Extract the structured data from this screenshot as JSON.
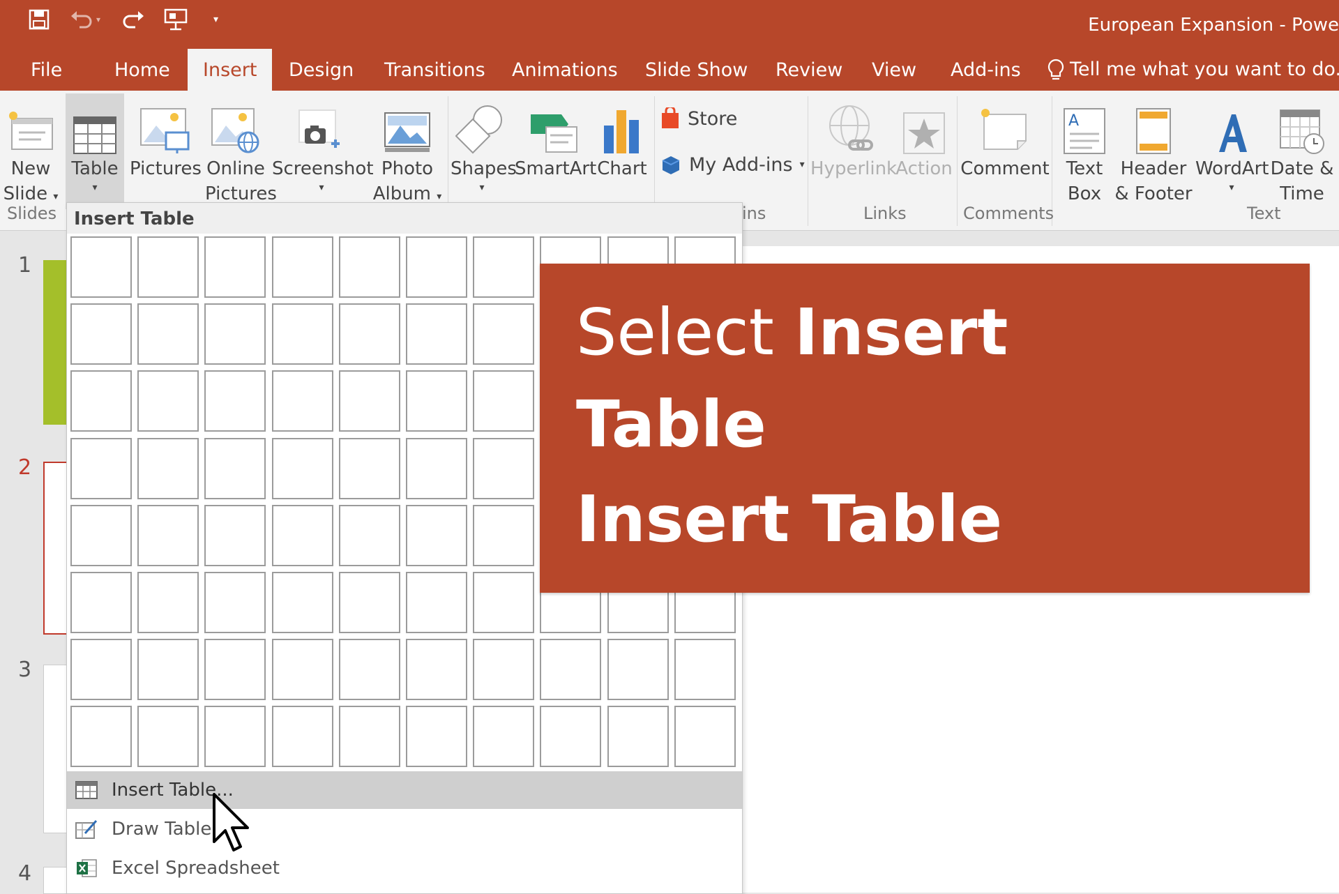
{
  "window": {
    "title": "European Expansion - Powe"
  },
  "quick_access": [
    {
      "icon": "save-icon"
    },
    {
      "icon": "undo-icon"
    },
    {
      "icon": "redo-icon"
    },
    {
      "icon": "present-from-start-icon"
    },
    {
      "icon": "customize-toolbar-icon"
    }
  ],
  "tabs": [
    {
      "label": "File"
    },
    {
      "label": "Home"
    },
    {
      "label": "Insert",
      "active": true
    },
    {
      "label": "Design"
    },
    {
      "label": "Transitions"
    },
    {
      "label": "Animations"
    },
    {
      "label": "Slide Show"
    },
    {
      "label": "Review"
    },
    {
      "label": "View"
    },
    {
      "label": "Add-ins"
    }
  ],
  "tell_me": {
    "placeholder": "Tell me what you want to do..."
  },
  "ribbon": {
    "new_slide": {
      "line1": "New",
      "line2": "Slide"
    },
    "table": {
      "label": "Table"
    },
    "pictures": {
      "label": "Pictures"
    },
    "online_pictures": {
      "line1": "Online",
      "line2": "Pictures"
    },
    "screenshot": {
      "label": "Screenshot"
    },
    "photo_album": {
      "line1": "Photo",
      "line2": "Album"
    },
    "shapes": {
      "label": "Shapes"
    },
    "smartart": {
      "label": "SmartArt"
    },
    "chart": {
      "label": "Chart"
    },
    "store": {
      "label": "Store"
    },
    "my_addins": {
      "label": "My Add-ins"
    },
    "hyperlink": {
      "label": "Hyperlink"
    },
    "action": {
      "label": "Action"
    },
    "comment": {
      "label": "Comment"
    },
    "text_box": {
      "line1": "Text",
      "line2": "Box"
    },
    "header_footer": {
      "line1": "Header",
      "line2": "& Footer"
    },
    "wordart": {
      "label": "WordArt"
    },
    "date_time": {
      "line1": "Date &",
      "line2": "Time"
    },
    "groups": {
      "slides": "Slides",
      "addins_partial": "ins",
      "links": "Links",
      "comments": "Comments",
      "text": "Text"
    }
  },
  "slide_numbers": [
    "1",
    "2",
    "3",
    "4"
  ],
  "insert_table_menu": {
    "header": "Insert Table",
    "grid": {
      "columns": 10,
      "rows": 8
    },
    "items": [
      {
        "label": "Insert Table...",
        "icon": "table-icon",
        "highlighted": true
      },
      {
        "label": "Draw Table",
        "icon": "draw-table-icon"
      },
      {
        "label": "Excel Spreadsheet",
        "icon": "excel-icon"
      }
    ]
  },
  "callout": {
    "line1_light": "Select ",
    "line1_bold": "Insert",
    "line2": "Table",
    "line3": "Insert Table"
  },
  "colors": {
    "accent": "#b7472a",
    "ribbon_bg": "#f3f3f3",
    "slide_thumb_green": "#a4bf2a",
    "current_slide": "#c0392b"
  }
}
